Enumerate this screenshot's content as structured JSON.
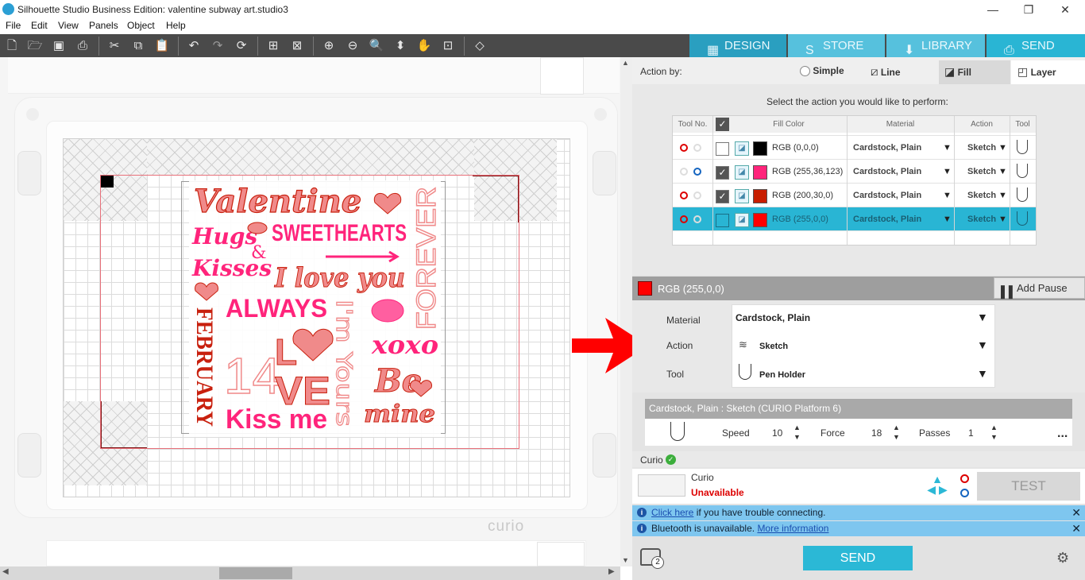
{
  "window": {
    "title": "Silhouette Studio Business Edition: valentine subway art.studio3",
    "minimize": "—",
    "maximize": "❐",
    "close": "✕"
  },
  "menu": [
    "File",
    "Edit",
    "View",
    "Panels",
    "Object",
    "Help"
  ],
  "toolbar_icons": [
    "new-file-icon",
    "open-file-icon",
    "save-icon",
    "print-icon",
    "cut-icon",
    "copy-icon",
    "paste-icon",
    "undo-icon",
    "redo-icon",
    "refresh-icon",
    "group-icon",
    "ungroup-icon",
    "zoom-in-icon",
    "zoom-out-icon",
    "zoom-select-icon",
    "move-icon",
    "pan-icon",
    "fit-page-icon",
    "transparency-icon"
  ],
  "top_tabs": [
    {
      "label": "DESIGN",
      "color": "#2a9fc0"
    },
    {
      "label": "STORE",
      "color": "#56c1dd"
    },
    {
      "label": "LIBRARY",
      "color": "#56c1dd"
    },
    {
      "label": "SEND",
      "color": "#29b5d4"
    }
  ],
  "canvas": {
    "mat_brand": "curio",
    "design_words": [
      "Valentine",
      "Hugs",
      "&",
      "Kisses",
      "SWEETHEARTS",
      "I love you",
      "FOREVER",
      "ALWAYS",
      "I'm Yours",
      "FEBRUARY",
      "14",
      "L",
      "VE",
      "xoxo",
      "Be",
      "mine",
      "Kiss me"
    ],
    "colors": {
      "red": "#c8200e",
      "pink": "#ff247b",
      "salmon": "#f08a8a"
    }
  },
  "action_by": {
    "label": "Action by:",
    "options": [
      "Simple",
      "Line",
      "Fill",
      "Layer"
    ],
    "selected": "Fill"
  },
  "select_message": "Select the action you would like to perform:",
  "table": {
    "headers": [
      "Tool No.",
      "Fill Color",
      "Material",
      "Action",
      "Tool"
    ],
    "rows": [
      {
        "checked": false,
        "swatch": "#000000",
        "color": "RGB (0,0,0)",
        "material": "Cardstock, Plain",
        "action": "Sketch",
        "tool": 1
      },
      {
        "checked": true,
        "swatch": "#ff247b",
        "color": "RGB (255,36,123)",
        "material": "Cardstock, Plain",
        "action": "Sketch",
        "tool": 2
      },
      {
        "checked": true,
        "swatch": "#c81e00",
        "color": "RGB (200,30,0)",
        "material": "Cardstock, Plain",
        "action": "Sketch",
        "tool": 1
      },
      {
        "checked": false,
        "swatch": "#ff0000",
        "color": "RGB (255,0,0)",
        "material": "Cardstock, Plain",
        "action": "Sketch",
        "tool": 1,
        "selected": true
      }
    ]
  },
  "selected_color": {
    "label": "RGB (255,0,0)",
    "swatch": "#ff0000",
    "add_pause": "Add Pause"
  },
  "settings": {
    "material_label": "Material",
    "material_value": "Cardstock, Plain",
    "action_label": "Action",
    "action_value": "Sketch",
    "tool_label": "Tool",
    "tool_value": "Pen Holder"
  },
  "profile": {
    "header": "Cardstock, Plain : Sketch (CURIO Platform 6)",
    "speed_label": "Speed",
    "speed": "10",
    "force_label": "Force",
    "force": "18",
    "passes_label": "Passes",
    "passes": "1",
    "more": "..."
  },
  "device": {
    "section": "Curio",
    "name": "Curio",
    "status": "Unavailable",
    "test": "TEST"
  },
  "info": [
    {
      "link": "Click here",
      "text": " if you have trouble connecting."
    },
    {
      "text": "Bluetooth is unavailable. ",
      "link": "More information"
    }
  ],
  "send_button": "SEND",
  "queue_count": "2"
}
